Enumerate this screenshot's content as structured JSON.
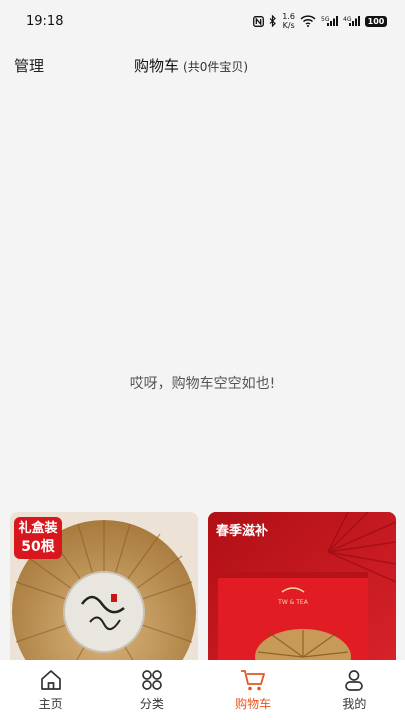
{
  "status_bar": {
    "time": "19:18",
    "net_speed_value": "1.6",
    "net_speed_unit": "K/s",
    "battery": "100"
  },
  "header": {
    "manage_label": "管理",
    "title": "购物车",
    "count_text": "(共0件宝贝)"
  },
  "empty_message": "哎呀，购物车空空如也!",
  "products": [
    {
      "badge_line1": "礼盒装",
      "badge_line2": "50根"
    },
    {
      "label": "春季滋补"
    }
  ],
  "nav": {
    "items": [
      {
        "label": "主页",
        "icon": "home-icon"
      },
      {
        "label": "分类",
        "icon": "category-icon"
      },
      {
        "label": "购物车",
        "icon": "cart-icon"
      },
      {
        "label": "我的",
        "icon": "profile-icon"
      }
    ],
    "active_index": 2
  },
  "colors": {
    "accent": "#e8541f",
    "badge_red": "#d8161e",
    "background": "#f4f4f4"
  }
}
